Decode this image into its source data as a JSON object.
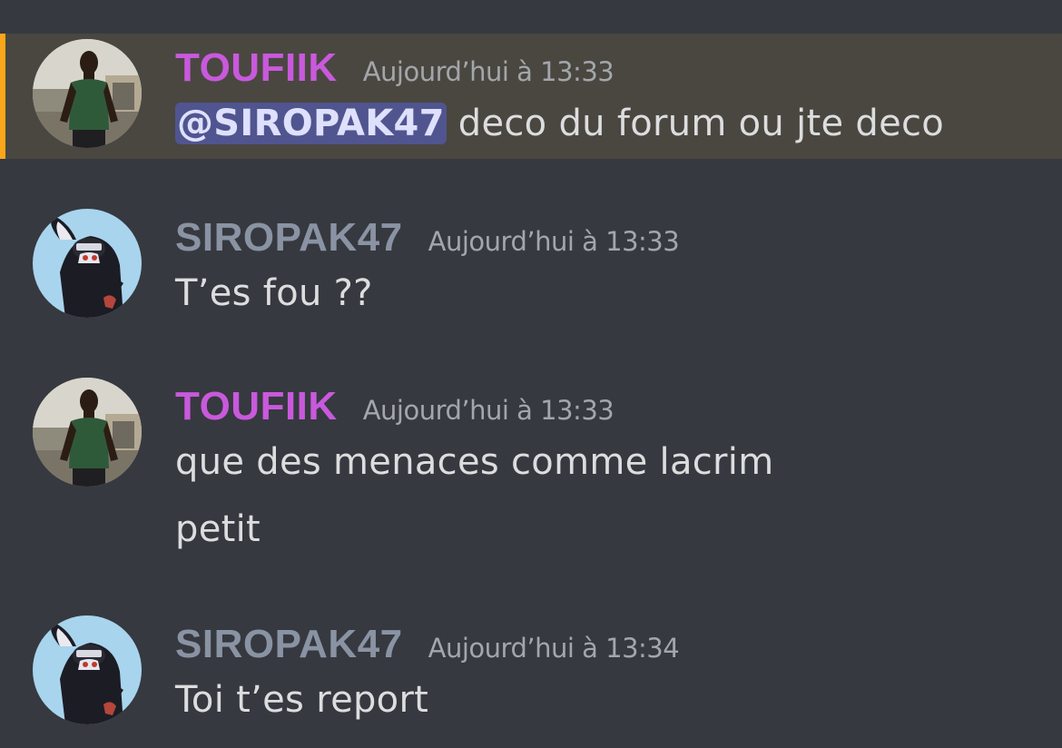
{
  "colors": {
    "background": "#36393f",
    "mention_highlight": "#4a4741",
    "mention_bar": "#faa61a",
    "toufiik_name": "#c959dc",
    "siropak_name": "#8a93a3",
    "message_text": "#dcddde",
    "timestamp": "#a3a6aa"
  },
  "messages": [
    {
      "author": "TOUFIIK",
      "timestamp": "Aujourd’hui à 13:33",
      "mention": "@SIROPAK47",
      "lines": [
        " deco du forum ou jte deco"
      ]
    },
    {
      "author": "SIROPAK47",
      "timestamp": "Aujourd’hui à 13:33",
      "lines": [
        "T’es fou ??"
      ]
    },
    {
      "author": "TOUFIIK",
      "timestamp": "Aujourd’hui à 13:33",
      "lines": [
        "que des menaces comme lacrim",
        "petit"
      ]
    },
    {
      "author": "SIROPAK47",
      "timestamp": "Aujourd’hui à 13:34",
      "lines": [
        "Toi t’es report"
      ]
    }
  ]
}
